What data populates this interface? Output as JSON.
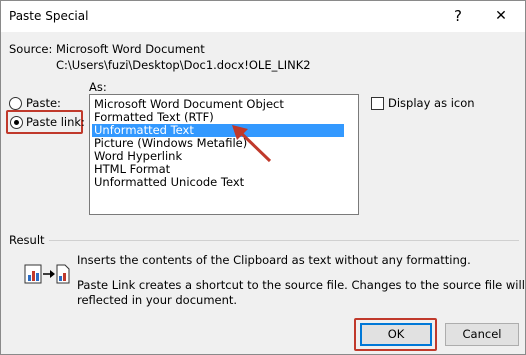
{
  "window": {
    "title": "Paste Special",
    "help_glyph": "?",
    "close_glyph": "✕"
  },
  "source": {
    "label": "Source:",
    "value": "Microsoft Word Document",
    "path": "C:\\Users\\fuzi\\Desktop\\Doc1.docx!OLE_LINK2"
  },
  "as_label": "As:",
  "options": {
    "paste_label": "Paste:",
    "paste_link_label": "Paste link:",
    "selected": "paste_link"
  },
  "formats": [
    "Microsoft Word Document Object",
    "Formatted Text (RTF)",
    "Unformatted Text",
    "Picture (Windows Metafile)",
    "Word Hyperlink",
    "HTML Format",
    "Unformatted Unicode Text"
  ],
  "selected_format": "Unformatted Text",
  "display_as_icon": {
    "label": "Display as icon",
    "checked": false
  },
  "result": {
    "label": "Result",
    "line1": "Inserts the contents of the Clipboard as text without any formatting.",
    "line2": "Paste Link creates a shortcut to the source file. Changes to the source file will be",
    "line3": "reflected in your document."
  },
  "buttons": {
    "ok": "OK",
    "cancel": "Cancel"
  },
  "colors": {
    "highlight": "#3399ff",
    "annotation_red": "#c0392b",
    "default_button_border": "#0078d7"
  }
}
